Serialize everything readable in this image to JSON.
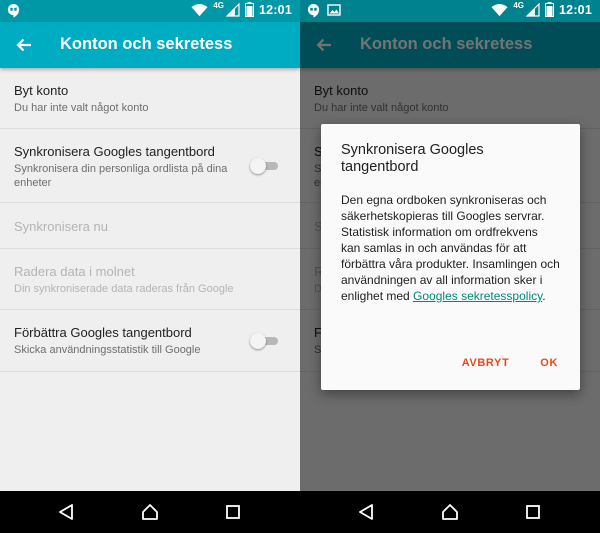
{
  "status": {
    "network": "4G",
    "time": "12:01",
    "icons": [
      "hangouts-icon",
      "wifi-icon",
      "cell-signal-icon",
      "battery-icon",
      "image-notification-icon"
    ]
  },
  "appbar": {
    "title": "Konton och sekretess",
    "color": "#00acc1"
  },
  "settings": {
    "items": [
      {
        "title": "Byt konto",
        "summary": "Du har inte valt något konto",
        "enabled": true
      },
      {
        "title": "Synkronisera Googles tangentbord",
        "summary": "Synkronisera din personliga ordlista på dina enheter",
        "enabled": true,
        "toggle": false
      },
      {
        "title": "Synkronisera nu",
        "enabled": false
      },
      {
        "title": "Radera data i molnet",
        "summary": "Din synkroniserade data raderas från Google",
        "enabled": false
      },
      {
        "title": "Förbättra Googles tangentbord",
        "summary": "Skicka användningsstatistik till Google",
        "enabled": true,
        "toggle": false
      }
    ]
  },
  "dialog": {
    "title": "Synkronisera Googles tangentbord",
    "body_pre": "Den egna ordboken synkroniseras och säkerhetskopieras till Googles servrar. Statistisk information om ordfrekvens kan samlas in och användas för att förbättra våra produkter. Insamlingen och användningen av all information sker i enlighet med ",
    "link_text": "Googles sekretesspolicy",
    "body_post": ".",
    "cancel_label": "AVBRYT",
    "ok_label": "OK",
    "accent": "#e64a19",
    "link_color": "#00897b"
  }
}
